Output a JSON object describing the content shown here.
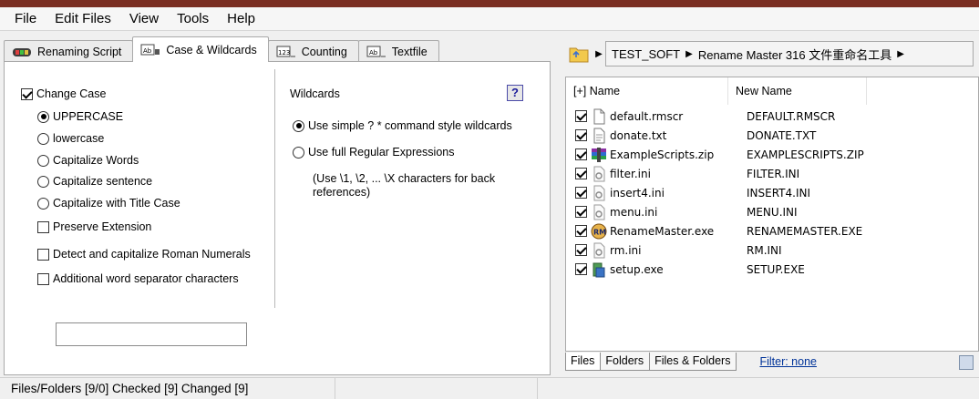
{
  "menu": [
    "File",
    "Edit Files",
    "View",
    "Tools",
    "Help"
  ],
  "tabs": [
    {
      "label": "Renaming Script",
      "icon": "script-icon"
    },
    {
      "label": "Case & Wildcards",
      "icon": "case-icon"
    },
    {
      "label": "Counting",
      "icon": "counting-icon"
    },
    {
      "label": "Textfile",
      "icon": "textfile-icon"
    }
  ],
  "case_options": {
    "change_case": "Change Case",
    "uppercase": "UPPERCASE",
    "lowercase": "lowercase",
    "capitalize_words": "Capitalize Words",
    "capitalize_sentence": "Capitalize sentence",
    "title_case": "Capitalize with Title Case",
    "preserve_extension": "Preserve Extension",
    "roman_numerals": "Detect and capitalize Roman Numerals",
    "word_separator": "Additional word separator characters",
    "word_separator_value": ""
  },
  "wildcards": {
    "title": "Wildcards",
    "help": "?",
    "simple": "Use simple ? * command style wildcards",
    "regex": "Use full Regular Expressions",
    "note": "(Use \\1, \\2, ... \\X characters for back references)"
  },
  "address": {
    "crumbs": [
      "TEST_SOFT",
      "Rename Master 316 文件重命名工具"
    ]
  },
  "list": {
    "header_name": "[+] Name",
    "header_new": "New Name",
    "files": [
      {
        "name": "default.rmscr",
        "new": "DEFAULT.RMSCR",
        "icon": "document-icon"
      },
      {
        "name": "donate.txt",
        "new": "DONATE.TXT",
        "icon": "text-file-icon"
      },
      {
        "name": "ExampleScripts.zip",
        "new": "EXAMPLESCRIPTS.ZIP",
        "icon": "archive-icon"
      },
      {
        "name": "filter.ini",
        "new": "FILTER.INI",
        "icon": "settings-file-icon"
      },
      {
        "name": "insert4.ini",
        "new": "INSERT4.INI",
        "icon": "settings-file-icon"
      },
      {
        "name": "menu.ini",
        "new": "MENU.INI",
        "icon": "settings-file-icon"
      },
      {
        "name": "RenameMaster.exe",
        "new": "RENAMEMASTER.EXE",
        "icon": "app-icon"
      },
      {
        "name": "rm.ini",
        "new": "RM.INI",
        "icon": "settings-file-icon"
      },
      {
        "name": "setup.exe",
        "new": "SETUP.EXE",
        "icon": "installer-icon"
      }
    ]
  },
  "bottom_tabs": [
    "Files",
    "Folders",
    "Files & Folders"
  ],
  "filter": "Filter: none",
  "status": "Files/Folders [9/0] Checked [9] Changed [9]"
}
